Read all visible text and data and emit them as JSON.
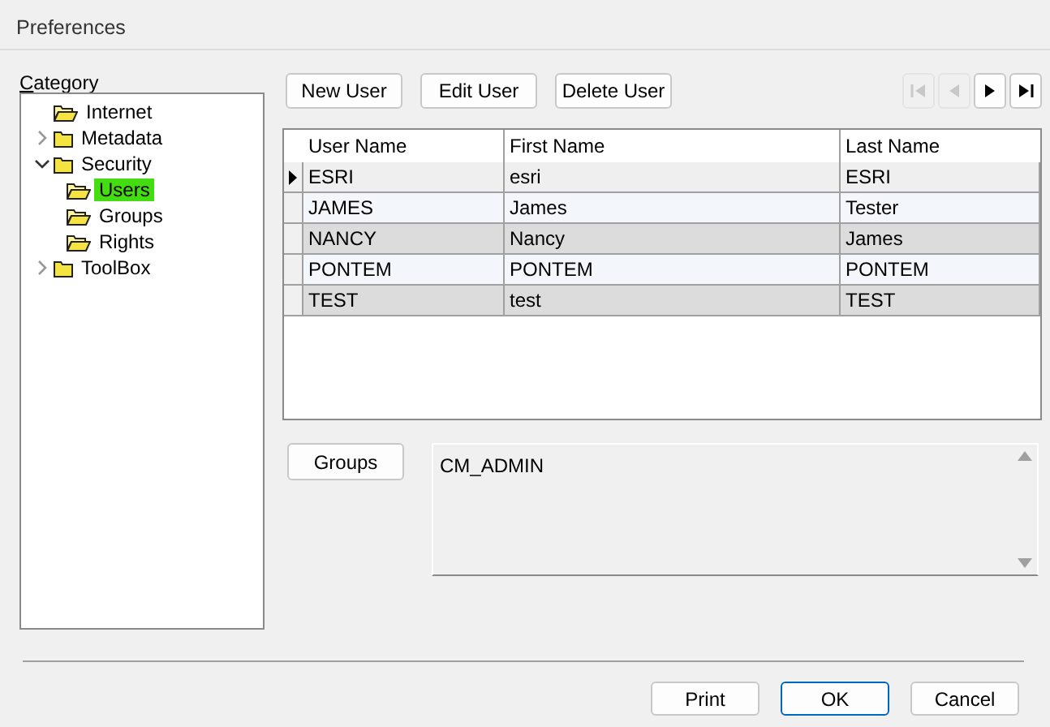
{
  "window": {
    "title": "Preferences"
  },
  "category": {
    "label": "Category",
    "tree": [
      {
        "label": "Internet",
        "selected": false
      },
      {
        "label": "Metadata",
        "expanded": false,
        "selected": false
      },
      {
        "label": "Security",
        "expanded": true,
        "selected": false,
        "children": [
          {
            "label": "Users",
            "selected": true
          },
          {
            "label": "Groups",
            "selected": false
          },
          {
            "label": "Rights",
            "selected": false
          }
        ]
      },
      {
        "label": "ToolBox",
        "expanded": false,
        "selected": false
      }
    ]
  },
  "toolbar": {
    "buttons": [
      "New User",
      "Edit User",
      "Delete User"
    ],
    "navigation": [
      {
        "kind": "first",
        "disabled": true
      },
      {
        "kind": "previous",
        "disabled": true
      },
      {
        "kind": "next",
        "disabled": false
      },
      {
        "kind": "last",
        "disabled": false
      }
    ]
  },
  "table": {
    "columns": [
      "User Name",
      "First Name",
      "Last Name"
    ],
    "rows": [
      {
        "cells": [
          "ESRI",
          "esri",
          "ESRI"
        ],
        "selected": true
      },
      {
        "cells": [
          "JAMES",
          "James",
          "Tester"
        ],
        "selected": false
      },
      {
        "cells": [
          "NANCY",
          "Nancy",
          "James"
        ],
        "selected": false
      },
      {
        "cells": [
          "PONTEM",
          "PONTEM",
          "PONTEM"
        ],
        "selected": false
      },
      {
        "cells": [
          "TEST",
          "test",
          "TEST"
        ],
        "selected": false
      }
    ]
  },
  "groups": {
    "button": "Groups",
    "items": [
      "CM_ADMIN"
    ]
  },
  "footer": {
    "buttons": [
      {
        "label": "Print",
        "default": false
      },
      {
        "label": "OK",
        "default": true
      },
      {
        "label": "Cancel",
        "default": false
      }
    ]
  }
}
